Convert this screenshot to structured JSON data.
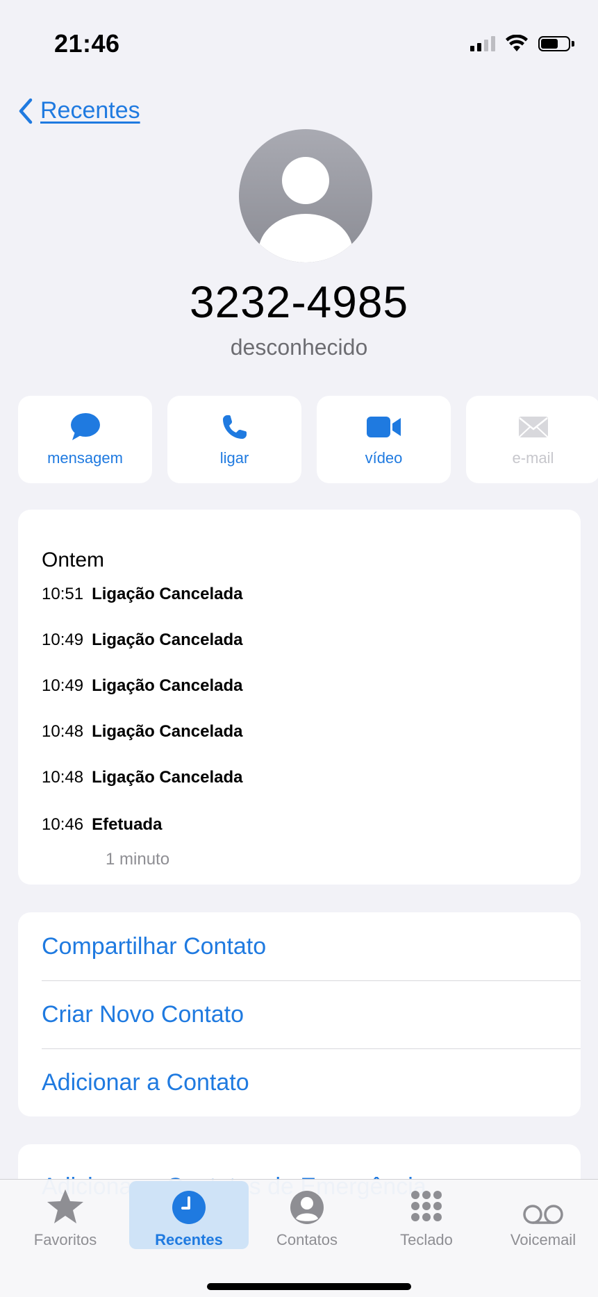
{
  "status_bar": {
    "time": "21:46"
  },
  "nav": {
    "back_label": "Recentes"
  },
  "contact": {
    "phone_number": "3232-4985",
    "label": "desconhecido"
  },
  "actions": [
    {
      "label": "mensagem",
      "icon": "message-bubble-icon",
      "enabled": true
    },
    {
      "label": "ligar",
      "icon": "phone-icon",
      "enabled": true
    },
    {
      "label": "vídeo",
      "icon": "video-camera-icon",
      "enabled": true
    },
    {
      "label": "e-mail",
      "icon": "envelope-icon",
      "enabled": false
    }
  ],
  "calls": {
    "day": "Ontem",
    "entries": [
      {
        "time": "10:51",
        "status": "Ligação Cancelada"
      },
      {
        "time": "10:49",
        "status": "Ligação Cancelada"
      },
      {
        "time": "10:49",
        "status": "Ligação Cancelada"
      },
      {
        "time": "10:48",
        "status": "Ligação Cancelada"
      },
      {
        "time": "10:48",
        "status": "Ligação Cancelada"
      },
      {
        "time": "10:46",
        "status": "Efetuada",
        "duration": "1 minuto"
      }
    ]
  },
  "options": [
    {
      "label": "Compartilhar Contato"
    },
    {
      "label": "Criar Novo Contato"
    },
    {
      "label": "Adicionar a Contato"
    }
  ],
  "emergency": {
    "label": "Adicionar a Contatos de Emergência"
  },
  "tabs": [
    {
      "label": "Favoritos",
      "icon": "star-icon",
      "active": false
    },
    {
      "label": "Recentes",
      "icon": "clock-icon",
      "active": true
    },
    {
      "label": "Contatos",
      "icon": "person-icon",
      "active": false
    },
    {
      "label": "Teclado",
      "icon": "keypad-icon",
      "active": false
    },
    {
      "label": "Voicemail",
      "icon": "voicemail-icon",
      "active": false
    }
  ],
  "colors": {
    "accent": "#1f7ae0",
    "background": "#f2f2f7",
    "card": "#ffffff",
    "secondary_text": "#8e8e93"
  }
}
